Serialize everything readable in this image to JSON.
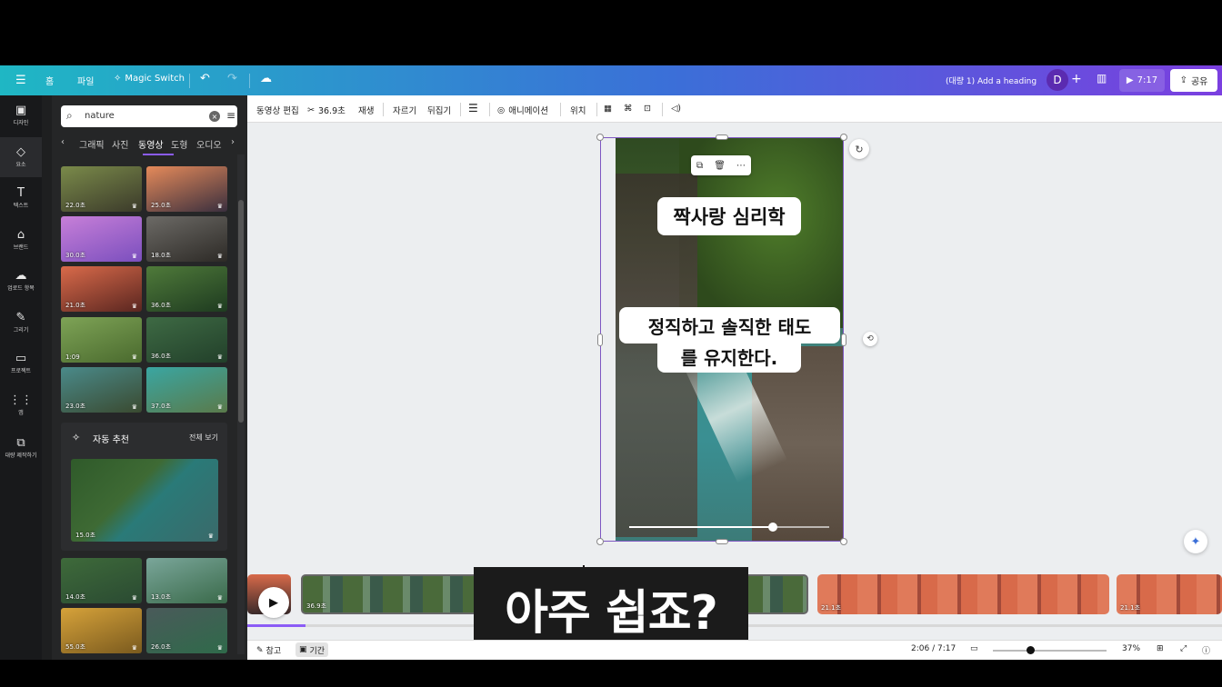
{
  "topbar": {
    "menu_icon": "menu-icon",
    "home": "홈",
    "file": "파일",
    "magic_switch": "Magic Switch",
    "title": "(대량 1) Add a heading",
    "avatar_initial": "D",
    "play_time": "7:17",
    "share": "공유"
  },
  "rail": [
    {
      "label": "디자인",
      "icon": "▣"
    },
    {
      "label": "요소",
      "icon": "◇"
    },
    {
      "label": "텍스트",
      "icon": "T"
    },
    {
      "label": "브랜드",
      "icon": "⌂"
    },
    {
      "label": "업로드 항목",
      "icon": "☁"
    },
    {
      "label": "그리기",
      "icon": "✎"
    },
    {
      "label": "프로젝트",
      "icon": "▭"
    },
    {
      "label": "앱",
      "icon": "⋮⋮"
    },
    {
      "label": "대량 제작하기",
      "icon": "⧉"
    }
  ],
  "panel": {
    "search_value": "nature",
    "tabs": [
      "그래픽",
      "사진",
      "동영상",
      "도형",
      "오디오"
    ],
    "active_tab": 2,
    "thumbs": [
      {
        "dur": "22.0초",
        "c1": "#7a8a4a",
        "c2": "#3b3a2a"
      },
      {
        "dur": "25.0초",
        "c1": "#e58a5a",
        "c2": "#3a2f3e"
      },
      {
        "dur": "30.0초",
        "c1": "#c77fd8",
        "c2": "#7b4fbe"
      },
      {
        "dur": "18.0초",
        "c1": "#6c6a66",
        "c2": "#2d2a26"
      },
      {
        "dur": "21.0초",
        "c1": "#d96a4a",
        "c2": "#5a2620"
      },
      {
        "dur": "36.0초",
        "c1": "#4f7a3a",
        "c2": "#1e3b20"
      },
      {
        "dur": "1:09",
        "c1": "#7ea356",
        "c2": "#4a6a2e"
      },
      {
        "dur": "36.0초",
        "c1": "#3e6a44",
        "c2": "#22402a"
      },
      {
        "dur": "23.0초",
        "c1": "#4a8a8a",
        "c2": "#3a4a30"
      },
      {
        "dur": "37.0초",
        "c1": "#3aa6a2",
        "c2": "#5a7a4a"
      }
    ],
    "auto_title": "자동 추천",
    "auto_all": "전체 보기",
    "auto_dur": "15.0초",
    "thumbs2": [
      {
        "dur": "14.0초",
        "c1": "#3e6a3a",
        "c2": "#2a4a32"
      },
      {
        "dur": "13.0초",
        "c1": "#7aa69a",
        "c2": "#3a6a4a"
      },
      {
        "dur": "55.0초",
        "c1": "#d6a23a",
        "c2": "#7a5a1e"
      },
      {
        "dur": "26.0초",
        "c1": "#4a5a5a",
        "c2": "#2f6a4a"
      }
    ]
  },
  "ctx": {
    "edit_video": "동영상 편집",
    "trim": "36.9초",
    "play": "재생",
    "crop": "자르기",
    "flip": "뒤집기",
    "animation": "애니메이션",
    "position": "위치"
  },
  "page": {
    "heading": "짝사랑 심리학",
    "line1": "정직하고 솔직한 태도",
    "line2": "를 유지한다.",
    "progress": 0.72
  },
  "timeline": {
    "clip1_len": "36.9초",
    "clip2_len": "21.1초",
    "clip3_len": "21.1초",
    "progress": 0.06
  },
  "subtitle": "아주 쉽죠?",
  "bottom": {
    "notes": "참고",
    "duration": "기간",
    "time": "2:06 / 7:17",
    "zoom": "37%",
    "zoom_level": 0.33
  }
}
